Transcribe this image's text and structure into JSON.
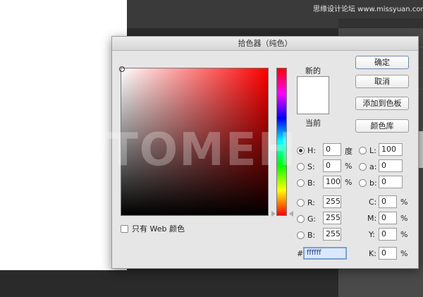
{
  "watermark": "FOTOMEH",
  "site_watermark": "思缘设计论坛 www.missyuan.com",
  "dialog": {
    "title": "拾色器（纯色）",
    "new_label": "新的",
    "current_label": "当前",
    "only_web_label": "只有 Web 颜色",
    "only_web_checked": false,
    "buttons": {
      "ok": "确定",
      "cancel": "取消",
      "add_to_swatches": "添加到色板",
      "color_libraries": "颜色库"
    },
    "fields": {
      "H": {
        "label": "H:",
        "value": "0",
        "unit": "度",
        "selected": true
      },
      "S": {
        "label": "S:",
        "value": "0",
        "unit": "%",
        "selected": false
      },
      "B": {
        "label": "B:",
        "value": "100",
        "unit": "%",
        "selected": false
      },
      "R": {
        "label": "R:",
        "value": "255",
        "selected": false
      },
      "G": {
        "label": "G:",
        "value": "255",
        "selected": false
      },
      "Bl": {
        "label": "B:",
        "value": "255",
        "selected": false
      },
      "L": {
        "label": "L:",
        "value": "100",
        "selected": false
      },
      "a": {
        "label": "a:",
        "value": "0",
        "selected": false
      },
      "b": {
        "label": "b:",
        "value": "0",
        "selected": false
      },
      "C": {
        "label": "C:",
        "value": "0",
        "unit": "%"
      },
      "M": {
        "label": "M:",
        "value": "0",
        "unit": "%"
      },
      "Y": {
        "label": "Y:",
        "value": "0",
        "unit": "%"
      },
      "K": {
        "label": "K:",
        "value": "0",
        "unit": "%"
      }
    },
    "hex_label": "#",
    "hex_value": "ffffff",
    "colors": {
      "current_color": "#ffffff",
      "new_color": "#ffffff",
      "hue_base": "#ff0000"
    }
  }
}
